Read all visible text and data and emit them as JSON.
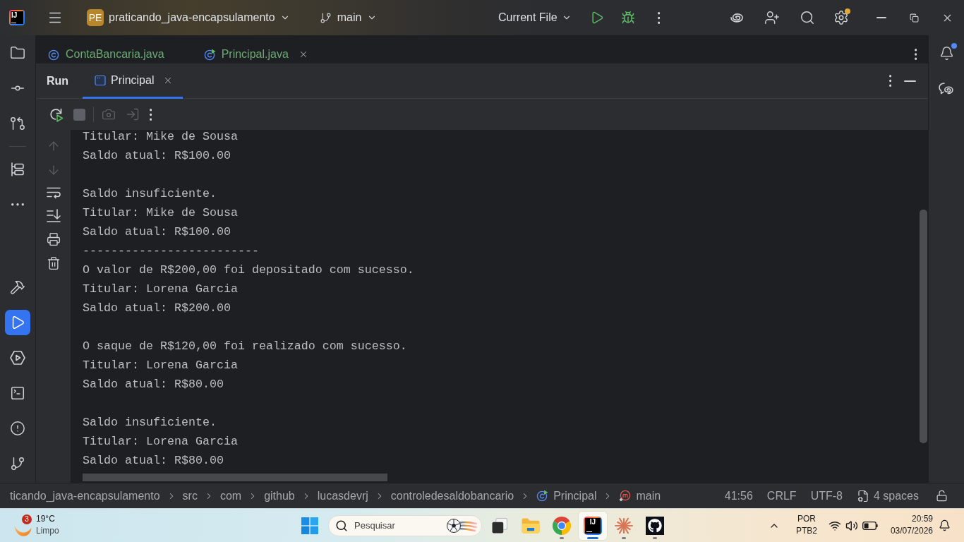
{
  "window": {
    "logo_text": "IJ",
    "project": {
      "badge": "PE",
      "name": "praticando_java-encapsulamento"
    },
    "branch": "main",
    "run_configuration": "Current File",
    "settings_badge": true
  },
  "left_toolbar": {
    "top_groups": [
      [
        {
          "kind": "project",
          "selected": false
        },
        {
          "kind": "commit",
          "selected": false
        },
        {
          "kind": "pull_requests",
          "selected": false
        }
      ],
      [
        {
          "kind": "structure",
          "selected": false
        },
        {
          "kind": "more",
          "selected": false
        }
      ]
    ],
    "bottom": [
      {
        "kind": "build",
        "selected": false
      },
      {
        "kind": "run",
        "selected": true
      },
      {
        "kind": "services",
        "selected": false
      },
      {
        "kind": "terminal",
        "selected": false
      },
      {
        "kind": "problems",
        "selected": false
      },
      {
        "kind": "git",
        "selected": false
      }
    ]
  },
  "editor_tabs": [
    {
      "label": "ContaBancaria.java",
      "kind": "class",
      "close_button": false
    },
    {
      "label": "Principal.java",
      "kind": "main_class",
      "close_button": true
    }
  ],
  "right_toolbar": [
    {
      "kind": "notifications",
      "badge": true
    },
    {
      "kind": "ai_chat",
      "badge": false
    }
  ],
  "run_panel": {
    "title": "Run",
    "tabs": [
      {
        "label": "Principal",
        "selected": true
      }
    ],
    "toolbar_groups": [
      [
        {
          "kind": "rerun",
          "disabled": false
        },
        {
          "kind": "stop",
          "disabled": true
        }
      ],
      [
        {
          "kind": "screenshot",
          "disabled": true
        },
        {
          "kind": "attach",
          "disabled": true
        },
        {
          "kind": "more",
          "disabled": false
        }
      ]
    ],
    "gutter": [
      {
        "kind": "scroll_up",
        "disabled": true
      },
      {
        "kind": "scroll_down",
        "disabled": true
      },
      {
        "kind": "soft_wrap",
        "disabled": false
      },
      {
        "kind": "scroll_to_end",
        "disabled": false
      },
      {
        "kind": "print",
        "disabled": false
      },
      {
        "kind": "clear",
        "disabled": false
      }
    ]
  },
  "console": {
    "blocks": [
      [
        "Titular: Mike de Sousa",
        "Saldo atual: R$100.00"
      ],
      [
        "Saldo insuficiente.",
        "Titular: Mike de Sousa",
        "Saldo atual: R$100.00",
        "-------------------------",
        "O valor de R$200,00 foi depositado com sucesso.",
        "Titular: Lorena Garcia",
        "Saldo atual: R$200.00"
      ],
      [
        "O saque de R$120,00 foi realizado com sucesso.",
        "Titular: Lorena Garcia",
        "Saldo atual: R$80.00"
      ],
      [
        "Saldo insuficiente.",
        "Titular: Lorena Garcia",
        "Saldo atual: R$80.00"
      ]
    ]
  },
  "status_bar": {
    "breadcrumbs": [
      {
        "label": "ticando_java-encapsulamento",
        "kind": "folder"
      },
      {
        "label": "src",
        "kind": "folder"
      },
      {
        "label": "com",
        "kind": "folder"
      },
      {
        "label": "github",
        "kind": "folder"
      },
      {
        "label": "lucasdevrj",
        "kind": "folder"
      },
      {
        "label": "controledesaldobancario",
        "kind": "folder"
      },
      {
        "label": "Principal",
        "kind": "main_class"
      },
      {
        "label": "main",
        "kind": "method"
      }
    ],
    "caret_position": "41:56",
    "line_separator": "CRLF",
    "encoding": "UTF-8",
    "indent": "4 spaces",
    "read_only": false
  },
  "taskbar": {
    "weather": {
      "badge": "3",
      "temperature": "19°C",
      "condition": "Limpo"
    },
    "search": {
      "placeholder": "Pesquisar"
    },
    "apps": [
      {
        "kind": "task_view",
        "running": false,
        "selected": false
      },
      {
        "kind": "file_explorer",
        "running": false,
        "selected": false
      },
      {
        "kind": "browser",
        "running": true,
        "selected": false
      },
      {
        "kind": "ide",
        "running": true,
        "selected": true,
        "logo_text": "IJ"
      },
      {
        "kind": "ai_assistant",
        "running": true,
        "selected": false
      },
      {
        "kind": "git_client",
        "running": true,
        "selected": false
      }
    ],
    "tray": {
      "input_language": "POR",
      "keyboard_layout": "PTB2",
      "time": "20:59",
      "date": "03/07/2026"
    }
  }
}
